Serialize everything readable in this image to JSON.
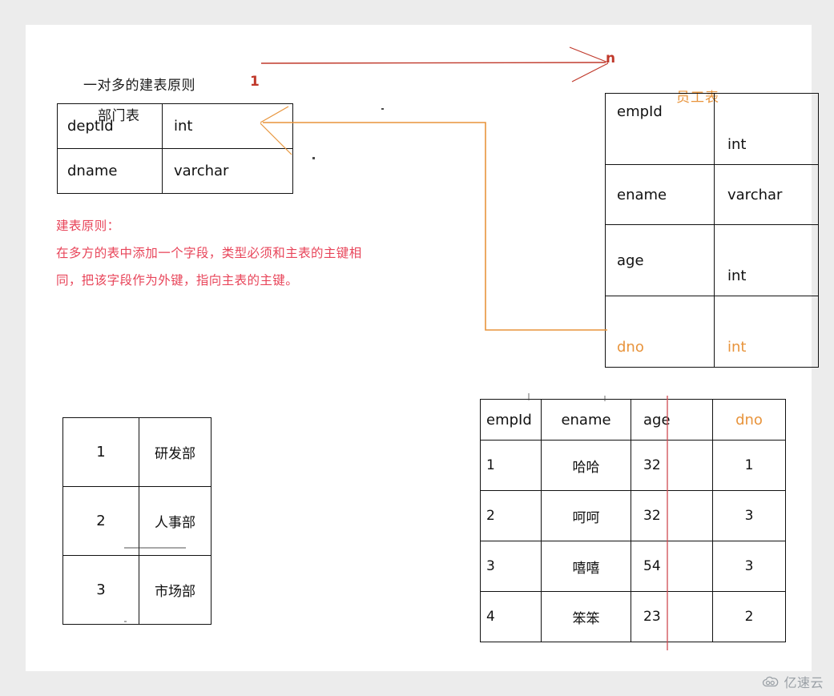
{
  "diagram": {
    "title": "一对多的建表原则",
    "dept_table_label": "部门表",
    "emp_table_label": "员工表",
    "cardinality_one": "1",
    "cardinality_many": "n",
    "rule_heading": "建表原则：",
    "rule_line1": "在多方的表中添加一个字段，类型必须和主表的主键相",
    "rule_line2": "同，把该字段作为外键，指向主表的主键。"
  },
  "dept_schema": {
    "rows": [
      {
        "field": "deptId",
        "type": "int"
      },
      {
        "field": "dname",
        "type": "varchar"
      }
    ]
  },
  "emp_schema": {
    "rows": [
      {
        "field": "empId",
        "type": "int"
      },
      {
        "field": "ename",
        "type": "varchar"
      },
      {
        "field": "age",
        "type": "int"
      },
      {
        "field": "dno",
        "type": "int"
      }
    ]
  },
  "dept_data": {
    "rows": [
      {
        "id": "1",
        "name": "研发部"
      },
      {
        "id": "2",
        "name": "人事部"
      },
      {
        "id": "3",
        "name": "市场部"
      }
    ]
  },
  "emp_data": {
    "headers": {
      "empId": "empId",
      "ename": "ename",
      "age": "age",
      "dno": "dno"
    },
    "rows": [
      {
        "empId": "1",
        "ename": "哈哈",
        "age": "32",
        "dno": "1"
      },
      {
        "empId": "2",
        "ename": "呵呵",
        "age": "32",
        "dno": "3"
      },
      {
        "empId": "3",
        "ename": "嘻嘻",
        "age": "54",
        "dno": "3"
      },
      {
        "empId": "4",
        "ename": "笨笨",
        "age": "23",
        "dno": "2"
      }
    ]
  },
  "colors": {
    "red_arrow": "#c0392b",
    "orange_arrow": "#e8943c",
    "rule_text": "#e8455a",
    "highlight_orange": "#e8943c",
    "ink": "#111111",
    "page_background": "#ffffff",
    "outer_background": "#ececec"
  },
  "watermark": {
    "text": "亿速云"
  }
}
